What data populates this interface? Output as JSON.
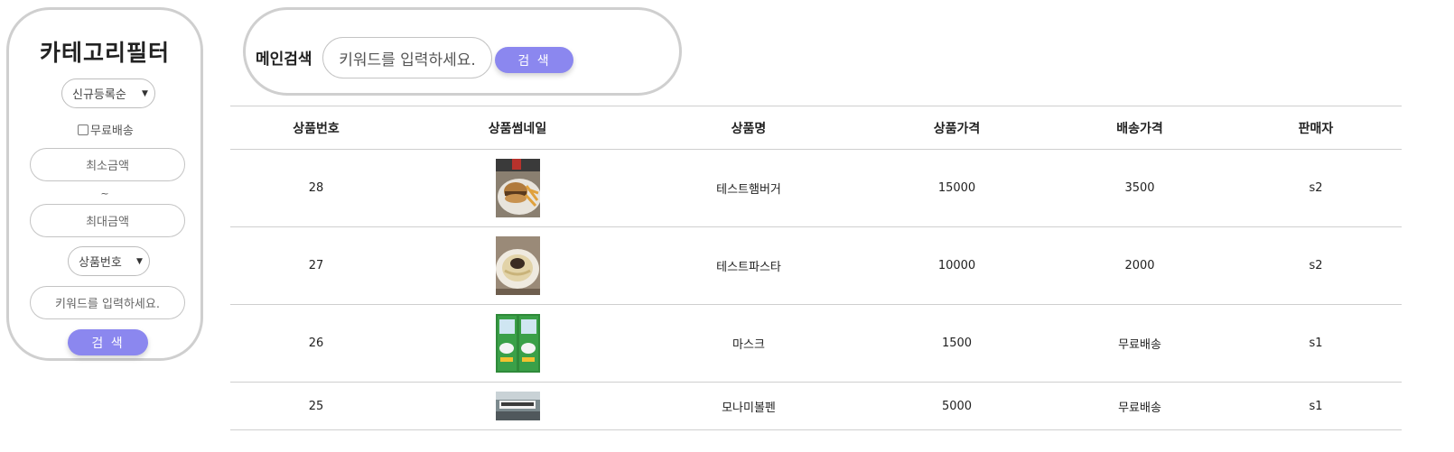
{
  "filter": {
    "title": "카테고리필터",
    "sort_select": "신규등록순",
    "free_shipping_label": "무료배송",
    "min_price_placeholder": "최소금액",
    "tilde": "~",
    "max_price_placeholder": "최대금액",
    "search_field_select": "상품번호",
    "keyword_placeholder": "키워드를 입력하세요.",
    "search_button": "검 색"
  },
  "main_search": {
    "label": "메인검색",
    "placeholder": "키워드를 입력하세요.",
    "button": "검 색"
  },
  "table": {
    "headers": [
      "상품번호",
      "상품썸네일",
      "상품명",
      "상품가격",
      "배송가격",
      "판매자"
    ],
    "rows": [
      {
        "id": "28",
        "thumbnail": "burger-photo",
        "name": "테스트햄버거",
        "price": "15000",
        "shipping": "3500",
        "seller": "s2"
      },
      {
        "id": "27",
        "thumbnail": "pasta-photo",
        "name": "테스트파스타",
        "price": "10000",
        "shipping": "2000",
        "seller": "s2"
      },
      {
        "id": "26",
        "thumbnail": "mask-photo",
        "name": "마스크",
        "price": "1500",
        "shipping": "무료배송",
        "seller": "s1"
      },
      {
        "id": "25",
        "thumbnail": "pen-photo",
        "name": "모나미볼펜",
        "price": "5000",
        "shipping": "무료배송",
        "seller": "s1"
      }
    ]
  },
  "colors": {
    "button_accent": "#8b87ef",
    "panel_border": "#cfcfcf"
  }
}
